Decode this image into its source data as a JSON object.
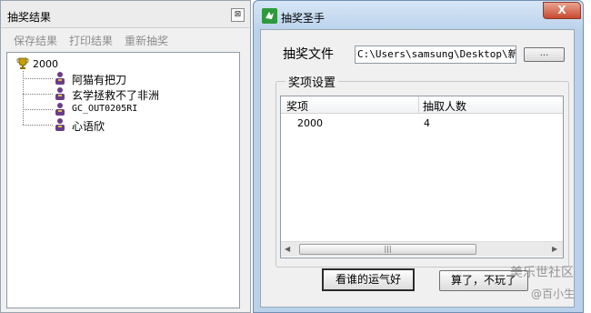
{
  "result_window": {
    "title": "抽奖结果",
    "close_glyph": "⊠",
    "menu": [
      "保存结果",
      "打印结果",
      "重新抽奖"
    ],
    "tree": {
      "root": "2000",
      "children": [
        "阿猫有把刀",
        "玄学拯救不了非洲",
        "GC_OUT0205RI",
        "心语欣"
      ]
    }
  },
  "main_window": {
    "title": "抽奖圣手",
    "close_glyph": "X",
    "file_label": "抽奖文件",
    "file_path": "C:\\Users\\samsung\\Desktop\\新建",
    "browse_label": "...",
    "group_title": "奖项设置",
    "columns": [
      "奖项",
      "抽取人数"
    ],
    "rows": [
      {
        "prize": "2000",
        "count": "4"
      }
    ],
    "scroll": {
      "left": "◀",
      "right": "▶",
      "grip": "|||"
    },
    "draw_button": "看谁的运气好",
    "quit_button": "算了，不玩了"
  },
  "watermark": {
    "line1": "美乐世社区",
    "line2": "@百小生"
  },
  "colors": {
    "titlebar": "#bcd3ec",
    "close_button": "#c74a30",
    "app_icon": "#2f9a3c",
    "trophy": "#c8a000",
    "person": "#6a3d8a"
  }
}
